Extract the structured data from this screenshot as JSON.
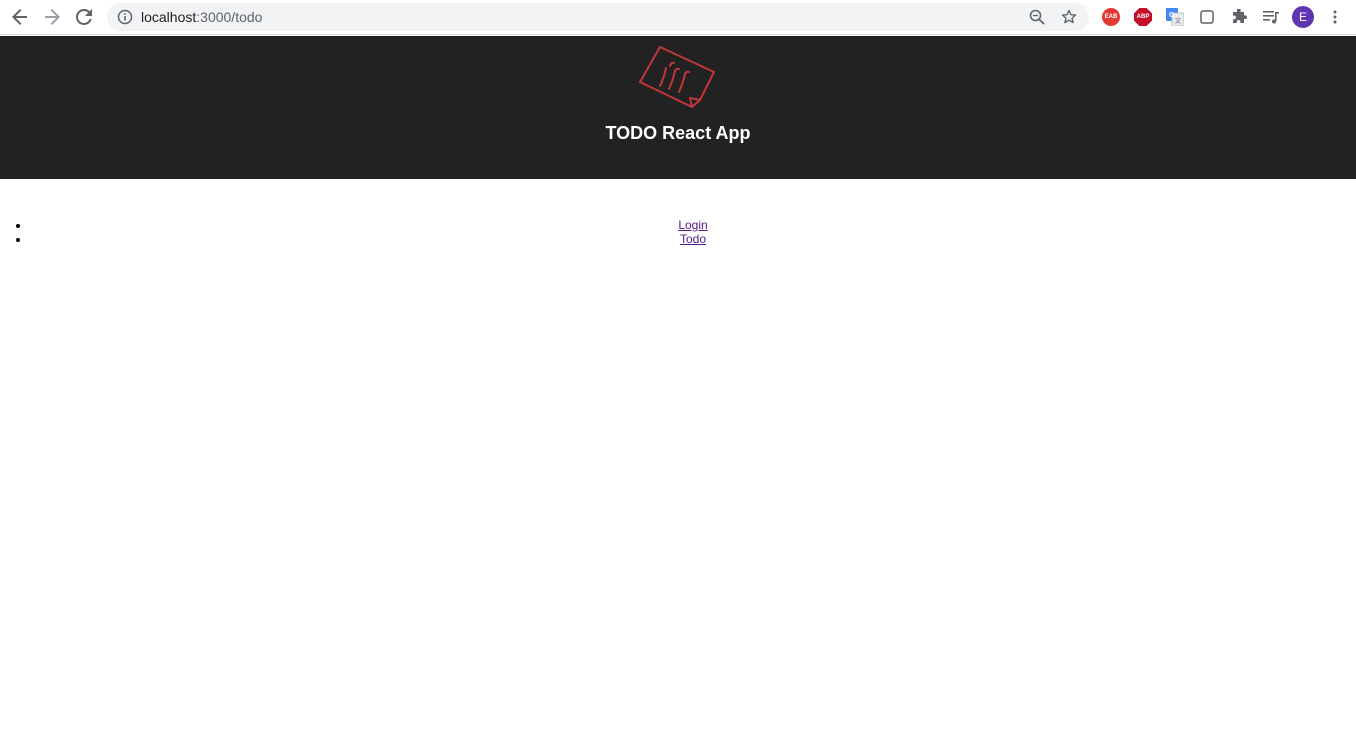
{
  "browser": {
    "url_host": "localhost",
    "url_port_path": ":3000/todo",
    "extensions": [
      "EAB",
      "ABP"
    ],
    "avatar_letter": "E"
  },
  "header": {
    "title": "TODO React App",
    "logo_color": "#c0373a",
    "background": "#222222"
  },
  "nav": {
    "items": [
      {
        "label": "Login"
      },
      {
        "label": "Todo"
      }
    ],
    "link_color": "#551a8b"
  },
  "icons": [
    "back-arrow-icon",
    "forward-arrow-icon",
    "reload-icon",
    "info-icon",
    "zoom-icon",
    "star-icon",
    "translate-icon",
    "square-icon",
    "puzzle-icon",
    "media-icon",
    "kebab-menu-icon"
  ]
}
